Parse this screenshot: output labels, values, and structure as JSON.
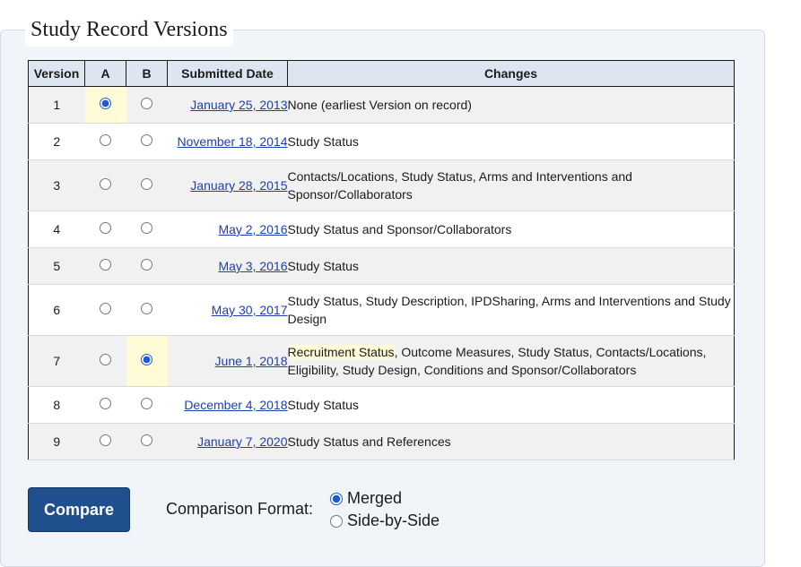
{
  "section": {
    "title": "Study Record Versions"
  },
  "table": {
    "headers": {
      "version": "Version",
      "a": "A",
      "b": "B",
      "date": "Submitted Date",
      "changes": "Changes"
    },
    "rows": [
      {
        "version": "1",
        "date": "January 25, 2013",
        "changes": "None (earliest Version on record)",
        "a_checked": true,
        "b_checked": false
      },
      {
        "version": "2",
        "date": "November 18, 2014",
        "changes": "Study Status",
        "a_checked": false,
        "b_checked": false
      },
      {
        "version": "3",
        "date": "January 28, 2015",
        "changes": "Contacts/Locations, Study Status, Arms and Interventions and Sponsor/Collaborators",
        "a_checked": false,
        "b_checked": false
      },
      {
        "version": "4",
        "date": "May 2, 2016",
        "changes": "Study Status and Sponsor/Collaborators",
        "a_checked": false,
        "b_checked": false
      },
      {
        "version": "5",
        "date": "May 3, 2016",
        "changes": "Study Status",
        "a_checked": false,
        "b_checked": false
      },
      {
        "version": "6",
        "date": "May 30, 2017",
        "changes": "Study Status, Study Description, IPDSharing, Arms and Interventions and Study Design",
        "a_checked": false,
        "b_checked": false
      },
      {
        "version": "7",
        "date": "June 1, 2018",
        "changes_highlight": "Recruitment Status",
        "changes_rest": ", Outcome Measures, Study Status, Contacts/Locations, Eligibility, Study Design, Conditions and Sponsor/Collaborators",
        "a_checked": false,
        "b_checked": true
      },
      {
        "version": "8",
        "date": "December 4, 2018",
        "changes": "Study Status",
        "a_checked": false,
        "b_checked": false
      },
      {
        "version": "9",
        "date": "January 7, 2020",
        "changes": "Study Status and References",
        "a_checked": false,
        "b_checked": false
      }
    ]
  },
  "compare_button": "Compare",
  "format": {
    "label": "Comparison Format:",
    "options": [
      {
        "label": "Merged",
        "checked": true
      },
      {
        "label": "Side-by-Side",
        "checked": false
      }
    ]
  },
  "colors": {
    "link": "#1d3fb0",
    "header_bg": "#dde5f0",
    "selected_bg": "#fffbd6",
    "button_bg": "#1f4f8c"
  }
}
